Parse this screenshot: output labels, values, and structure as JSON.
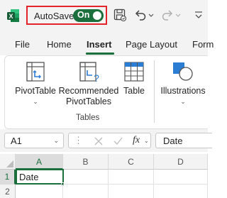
{
  "titlebar": {
    "autosave_label": "AutoSave",
    "autosave_state": "On",
    "accent_color": "#1b6f3c",
    "highlight_color": "#e3242b",
    "icons": [
      "excel-icon",
      "save-icon",
      "undo-icon",
      "redo-icon"
    ]
  },
  "tabs": [
    "File",
    "Home",
    "Insert",
    "Page Layout",
    "Form"
  ],
  "active_tab": "Insert",
  "ribbon": {
    "pivottable": "PivotTable",
    "recommended_line1": "Recommended",
    "recommended_line2": "PivotTables",
    "table": "Table",
    "illustrations": "Illustrations",
    "group_label": "Tables"
  },
  "formula_bar": {
    "name_box": "A1",
    "fx": "fx",
    "formula": "Date"
  },
  "grid": {
    "columns": [
      "A",
      "B",
      "C",
      "D"
    ],
    "rows": [
      "1",
      "2"
    ],
    "cells": {
      "A1": "Date"
    }
  }
}
